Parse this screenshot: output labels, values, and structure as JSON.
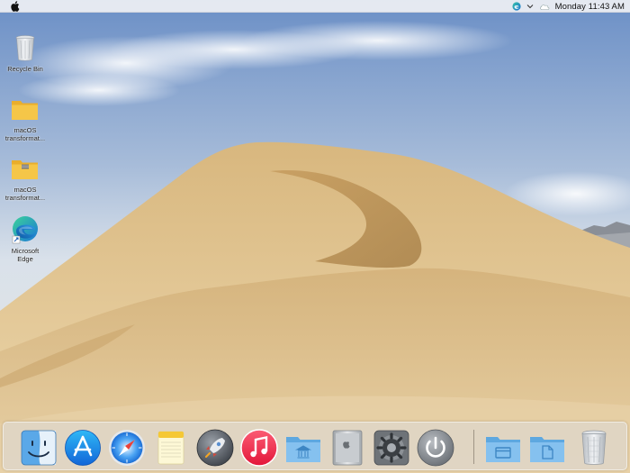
{
  "menubar": {
    "apple_icon": "apple-icon",
    "tray_icons": [
      "edge-tray-icon",
      "chevron-down-icon",
      "cloud-icon"
    ],
    "clock": "Monday 11:43 AM"
  },
  "desktop": {
    "icons": [
      {
        "label": "Recycle Bin",
        "icon": "trash-icon"
      },
      {
        "label_line1": "macOS",
        "label_line2": "transformat...",
        "icon": "folder-icon"
      },
      {
        "label_line1": "macOS",
        "label_line2": "transformat...",
        "icon": "zip-folder-icon"
      },
      {
        "label_line1": "Microsoft",
        "label_line2": "Edge",
        "icon": "edge-icon"
      }
    ]
  },
  "dock": {
    "items": [
      {
        "name": "Finder",
        "icon": "finder-icon"
      },
      {
        "name": "App Store",
        "icon": "app-store-icon"
      },
      {
        "name": "Safari",
        "icon": "safari-icon"
      },
      {
        "name": "Notes",
        "icon": "notes-icon"
      },
      {
        "name": "Launchpad",
        "icon": "launchpad-icon"
      },
      {
        "name": "Music",
        "icon": "music-icon"
      },
      {
        "name": "Applications",
        "icon": "applications-folder-icon"
      },
      {
        "name": "Computer",
        "icon": "computer-icon"
      },
      {
        "name": "System Preferences",
        "icon": "system-preferences-icon"
      },
      {
        "name": "Shut Down",
        "icon": "power-icon"
      },
      {
        "name": "Documents",
        "icon": "documents-folder-icon"
      },
      {
        "name": "Files",
        "icon": "files-folder-icon"
      },
      {
        "name": "Trash",
        "icon": "trash-icon"
      }
    ]
  },
  "colors": {
    "sky_top": "#6f93c8",
    "sky_horizon": "#dfe6ee",
    "dune_light": "#e3c998",
    "dune_shadow": "#b58f55",
    "folder_blue": "#7fb8e6",
    "folder_yellow": "#f5c344"
  }
}
